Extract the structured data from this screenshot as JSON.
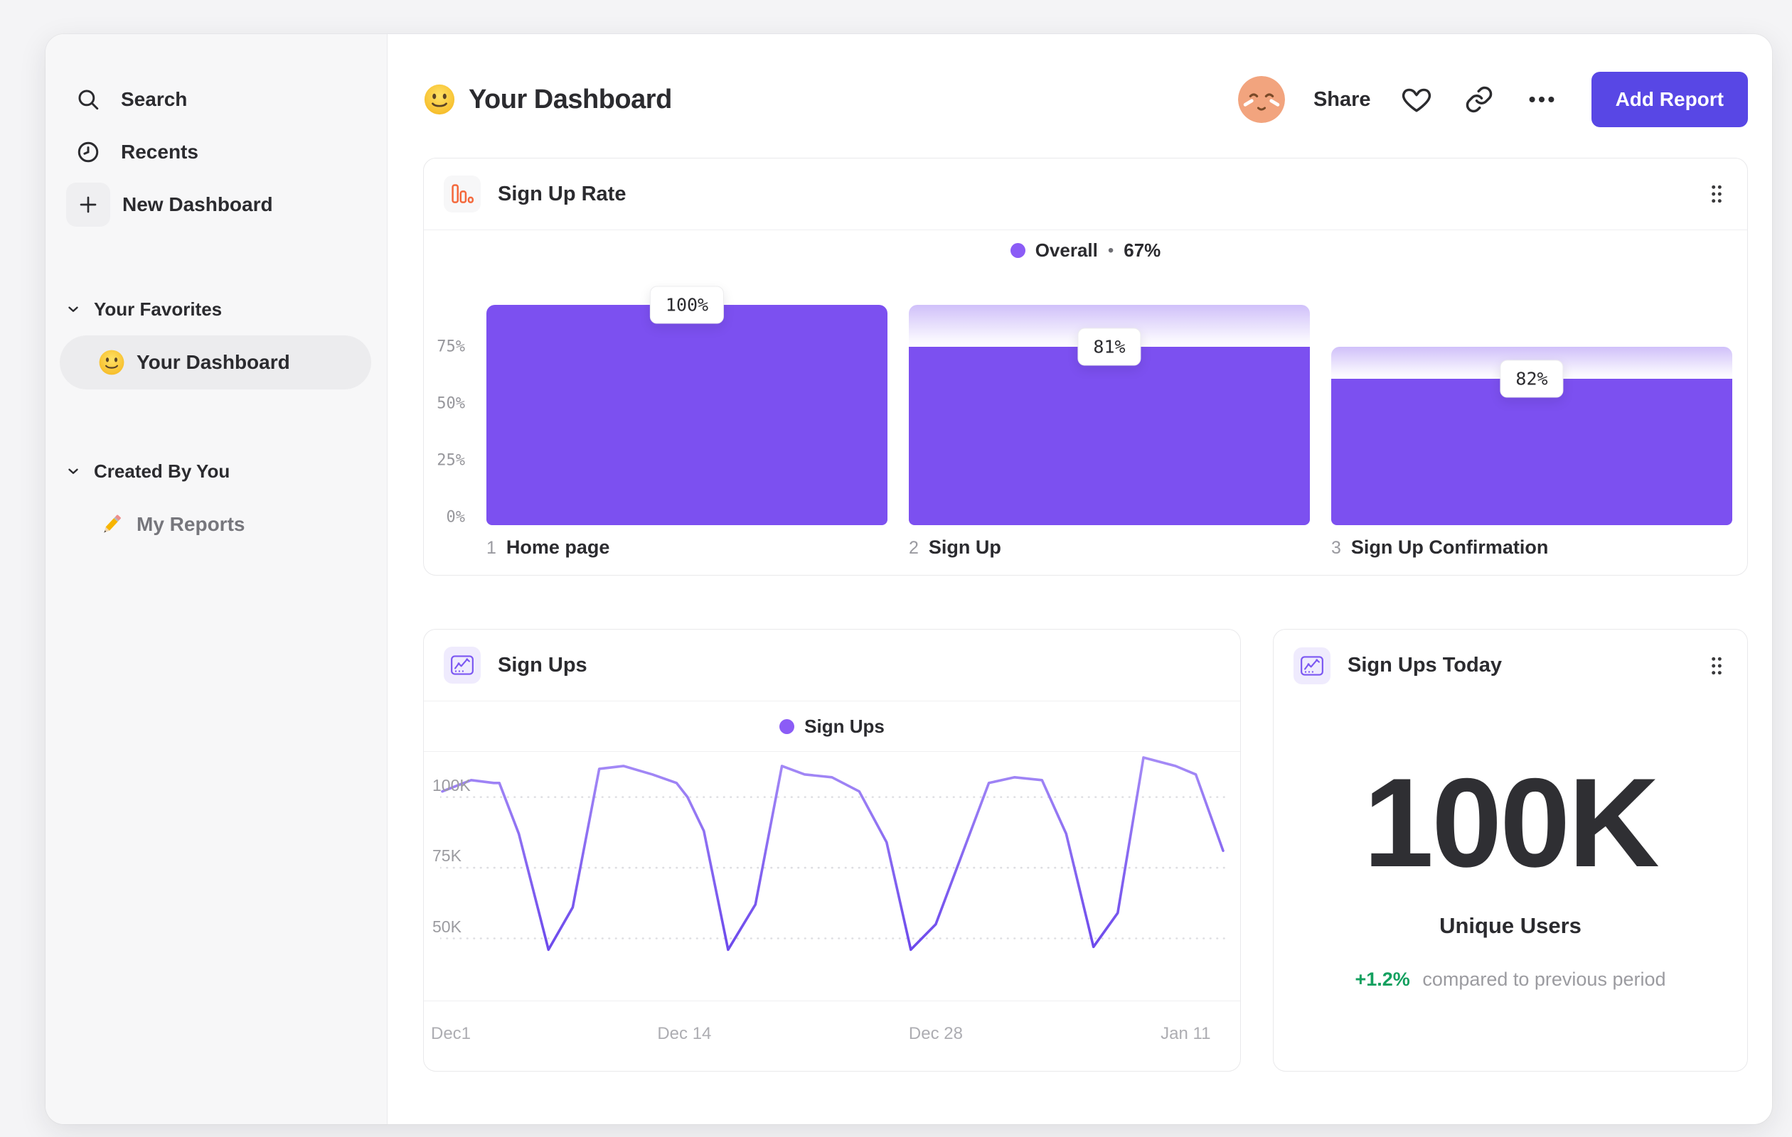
{
  "colors": {
    "accent_purple": "#7C50F0",
    "legend_purple": "#8B5CF6",
    "line_purple": "#7B57F2",
    "button_indigo": "#5847E5",
    "icon_orange": "#F4683B",
    "positive_green": "#13A05F"
  },
  "sidebar": {
    "items": [
      {
        "icon": "search-icon",
        "label": "Search"
      },
      {
        "icon": "clock-icon",
        "label": "Recents"
      },
      {
        "icon": "plus-icon",
        "label": "New Dashboard"
      }
    ],
    "sections": [
      {
        "header": "Your Favorites",
        "items": [
          {
            "icon": "smiley-emoji",
            "label": "Your Dashboard",
            "selected": true
          }
        ]
      },
      {
        "header": "Created By You",
        "items": [
          {
            "icon": "pencil-emoji",
            "label": "My Reports",
            "selected": false
          }
        ]
      }
    ]
  },
  "header": {
    "emoji": "smiley-emoji",
    "title": "Your Dashboard",
    "share_label": "Share",
    "add_report_label": "Add Report",
    "icons": [
      "avatar",
      "heart-icon",
      "link-icon",
      "more-icon"
    ]
  },
  "chart_data": [
    {
      "type": "bar",
      "chart": "funnel",
      "title": "Sign Up Rate",
      "legend": {
        "label": "Overall",
        "separator": "•",
        "value": "67%"
      },
      "y_ticks": [
        "75%",
        "50%",
        "25%",
        "0%"
      ],
      "ylim": [
        0,
        100
      ],
      "steps": [
        {
          "index": "1",
          "label": "Home page",
          "display": "100%",
          "prev": 100,
          "solid": 100
        },
        {
          "index": "2",
          "label": "Sign Up",
          "display": "81%",
          "prev": 100,
          "solid": 81
        },
        {
          "index": "3",
          "label": "Sign Up Confirmation",
          "display": "82%",
          "prev": 81,
          "solid": 66.4
        }
      ]
    },
    {
      "type": "line",
      "title": "Sign Ups",
      "legend": {
        "label": "Sign Ups"
      },
      "x_ticks": [
        {
          "label": "Dec1",
          "pct": 0,
          "align": "left"
        },
        {
          "label": "Dec 14",
          "pct": 31
        },
        {
          "label": "Dec 28",
          "pct": 63.2
        },
        {
          "label": "Jan 11",
          "pct": 95.2
        }
      ],
      "y_ticks": [
        {
          "label": "100K",
          "value": 100
        },
        {
          "label": "75K",
          "value": 75
        },
        {
          "label": "50K",
          "value": 50
        }
      ],
      "y_range": [
        28,
        116
      ],
      "unit": "K",
      "points": [
        [
          0,
          102
        ],
        [
          3.7,
          106
        ],
        [
          6.6,
          105
        ],
        [
          7.3,
          105
        ],
        [
          9.8,
          87
        ],
        [
          13.6,
          46
        ],
        [
          16.7,
          61
        ],
        [
          20.1,
          110
        ],
        [
          23.2,
          111
        ],
        [
          26.9,
          108
        ],
        [
          30,
          105
        ],
        [
          31.4,
          100
        ],
        [
          33.5,
          88
        ],
        [
          36.6,
          46
        ],
        [
          40.1,
          62
        ],
        [
          43.5,
          111
        ],
        [
          46.4,
          108
        ],
        [
          49.9,
          107
        ],
        [
          53.4,
          102
        ],
        [
          56.9,
          84
        ],
        [
          60,
          46
        ],
        [
          63.2,
          55
        ],
        [
          70,
          105
        ],
        [
          73.3,
          107
        ],
        [
          76.8,
          106
        ],
        [
          79.9,
          87
        ],
        [
          83.4,
          47
        ],
        [
          86.5,
          59
        ],
        [
          89.8,
          114
        ],
        [
          93.9,
          111
        ],
        [
          96.5,
          108
        ],
        [
          100,
          81
        ]
      ]
    },
    {
      "type": "metric",
      "title": "Sign Ups Today",
      "value": "100K",
      "label": "Unique Users",
      "delta": "+1.2%",
      "delta_note": "compared to previous period"
    }
  ]
}
